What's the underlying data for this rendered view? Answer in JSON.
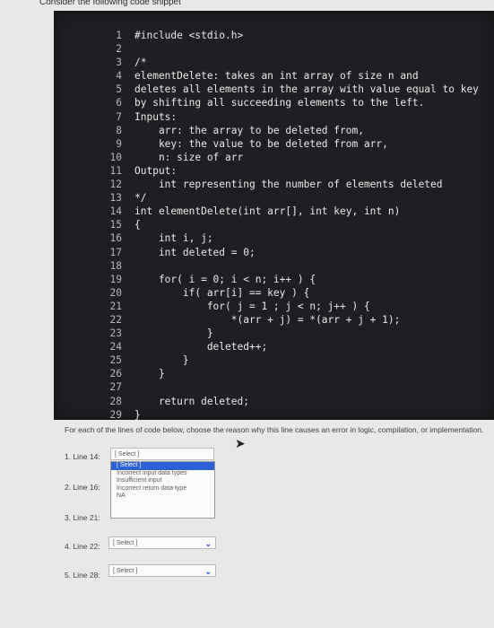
{
  "intro": "Consider the following code snippet",
  "code_lines": [
    {
      "n": "1",
      "t": "#include <stdio.h>"
    },
    {
      "n": "2",
      "t": ""
    },
    {
      "n": "3",
      "t": "/*"
    },
    {
      "n": "4",
      "t": "elementDelete: takes an int array of size n and"
    },
    {
      "n": "5",
      "t": "deletes all elements in the array with value equal to key"
    },
    {
      "n": "6",
      "t": "by shifting all succeeding elements to the left."
    },
    {
      "n": "7",
      "t": "Inputs:"
    },
    {
      "n": "8",
      "t": "    arr: the array to be deleted from,"
    },
    {
      "n": "9",
      "t": "    key: the value to be deleted from arr,"
    },
    {
      "n": "10",
      "t": "    n: size of arr"
    },
    {
      "n": "11",
      "t": "Output:"
    },
    {
      "n": "12",
      "t": "    int representing the number of elements deleted"
    },
    {
      "n": "13",
      "t": "*/"
    },
    {
      "n": "14",
      "t": "int elementDelete(int arr[], int key, int n)"
    },
    {
      "n": "15",
      "t": "{"
    },
    {
      "n": "16",
      "t": "    int i, j;"
    },
    {
      "n": "17",
      "t": "    int deleted = 0;"
    },
    {
      "n": "18",
      "t": ""
    },
    {
      "n": "19",
      "t": "    for( i = 0; i < n; i++ ) {"
    },
    {
      "n": "20",
      "t": "        if( arr[i] == key ) {"
    },
    {
      "n": "21",
      "t": "            for( j = 1 ; j < n; j++ ) {"
    },
    {
      "n": "22",
      "t": "                *(arr + j) = *(arr + j + 1);"
    },
    {
      "n": "23",
      "t": "            }"
    },
    {
      "n": "24",
      "t": "            deleted++;"
    },
    {
      "n": "25",
      "t": "        }"
    },
    {
      "n": "26",
      "t": "    }"
    },
    {
      "n": "27",
      "t": ""
    },
    {
      "n": "28",
      "t": "    return deleted;"
    },
    {
      "n": "29",
      "t": "}"
    }
  ],
  "instructions": "For each of the lines of code below, choose the reason why this line causes an error in logic, compilation, or implementation.",
  "questions": [
    {
      "label": "1. Line 14:",
      "value": "[ Select ]"
    },
    {
      "label": "2. Line 16:",
      "value": ""
    },
    {
      "label": "3. Line 21:",
      "value": ""
    },
    {
      "label": "4. Line 22:",
      "value": "[ Select ]"
    },
    {
      "label": "5. Line 28:",
      "value": "[ Select ]"
    }
  ],
  "dropdown_options": [
    "[ Select ]",
    "Incorrect input data types",
    "Insufficient input",
    "Incorrect return data type",
    "NA"
  ]
}
